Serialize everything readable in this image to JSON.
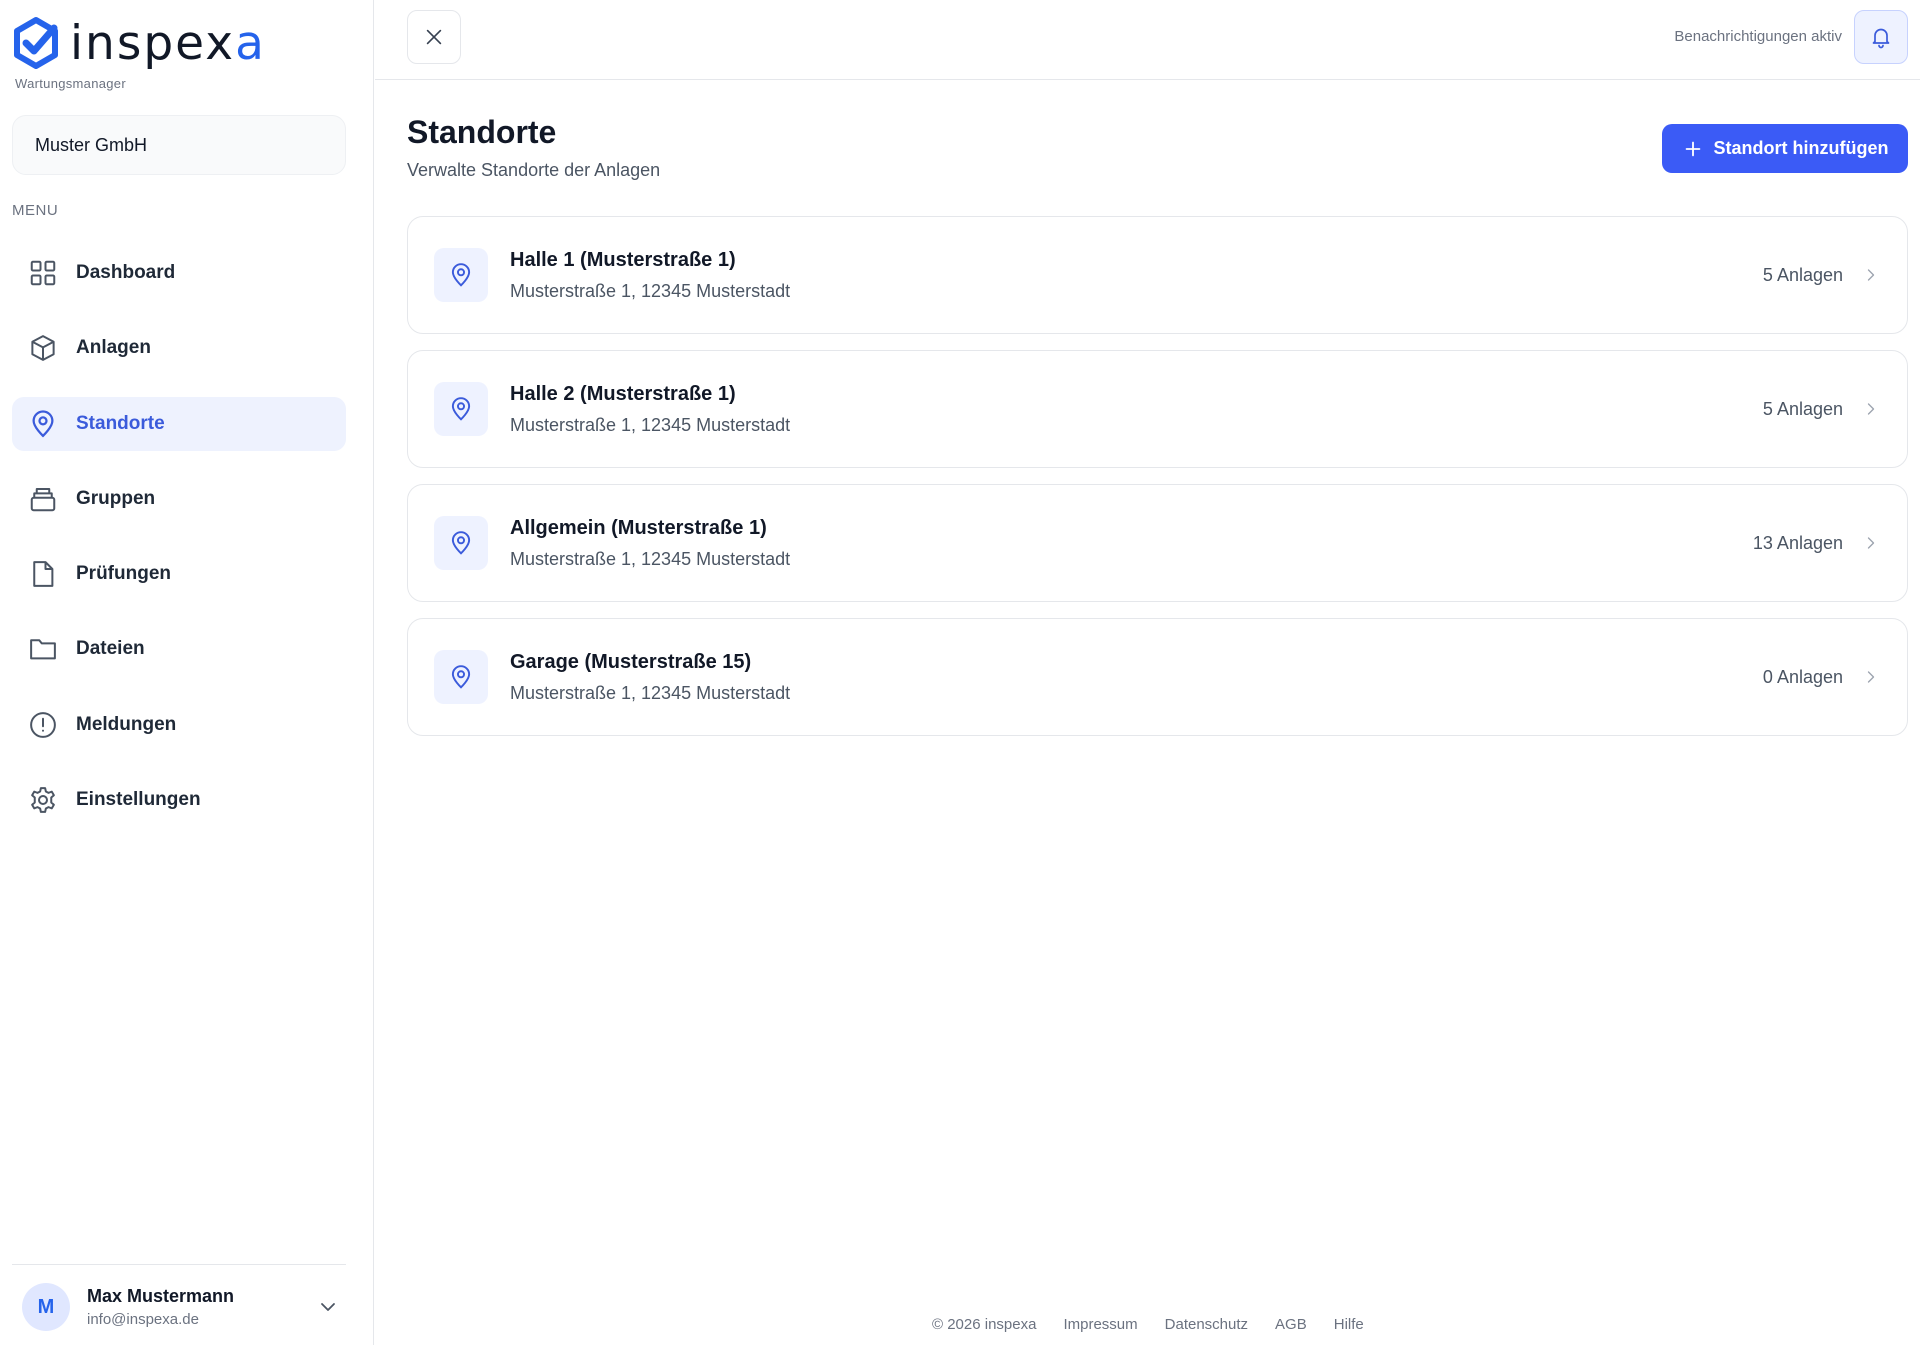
{
  "brand": {
    "name_main": "inspex",
    "name_accent": "a",
    "subtitle": "Wartungsmanager",
    "accent_color": "#2563eb"
  },
  "company": {
    "name": "Muster GmbH"
  },
  "sidebar": {
    "menu_label": "MENU",
    "items": [
      {
        "label": "Dashboard",
        "icon": "grid-icon"
      },
      {
        "label": "Anlagen",
        "icon": "cube-icon"
      },
      {
        "label": "Standorte",
        "icon": "map-pin-icon",
        "active": true
      },
      {
        "label": "Gruppen",
        "icon": "stack-icon"
      },
      {
        "label": "Prüfungen",
        "icon": "document-icon"
      },
      {
        "label": "Dateien",
        "icon": "folder-icon"
      },
      {
        "label": "Meldungen",
        "icon": "alert-circle-icon"
      },
      {
        "label": "Einstellungen",
        "icon": "gear-icon"
      }
    ]
  },
  "user": {
    "initial": "M",
    "name": "Max Mustermann",
    "email": "info@inspexa.de"
  },
  "topbar": {
    "notifications_status": "Benachrichtigungen aktiv"
  },
  "page": {
    "title": "Standorte",
    "subtitle": "Verwalte Standorte der Anlagen",
    "add_button_label": "Standort hinzufügen"
  },
  "locations": [
    {
      "name": "Halle 1 (Musterstraße 1)",
      "address": "Musterstraße 1, 12345 Musterstadt",
      "count": "5 Anlagen"
    },
    {
      "name": "Halle 2 (Musterstraße 1)",
      "address": "Musterstraße 1, 12345 Musterstadt",
      "count": "5 Anlagen"
    },
    {
      "name": "Allgemein (Musterstraße 1)",
      "address": "Musterstraße 1, 12345 Musterstadt",
      "count": "13 Anlagen"
    },
    {
      "name": "Garage (Musterstraße 15)",
      "address": "Musterstraße 1, 12345 Musterstadt",
      "count": "0 Anlagen"
    }
  ],
  "footer": {
    "copyright": "© 2026 inspexa",
    "links": [
      "Impressum",
      "Datenschutz",
      "AGB",
      "Hilfe"
    ]
  }
}
